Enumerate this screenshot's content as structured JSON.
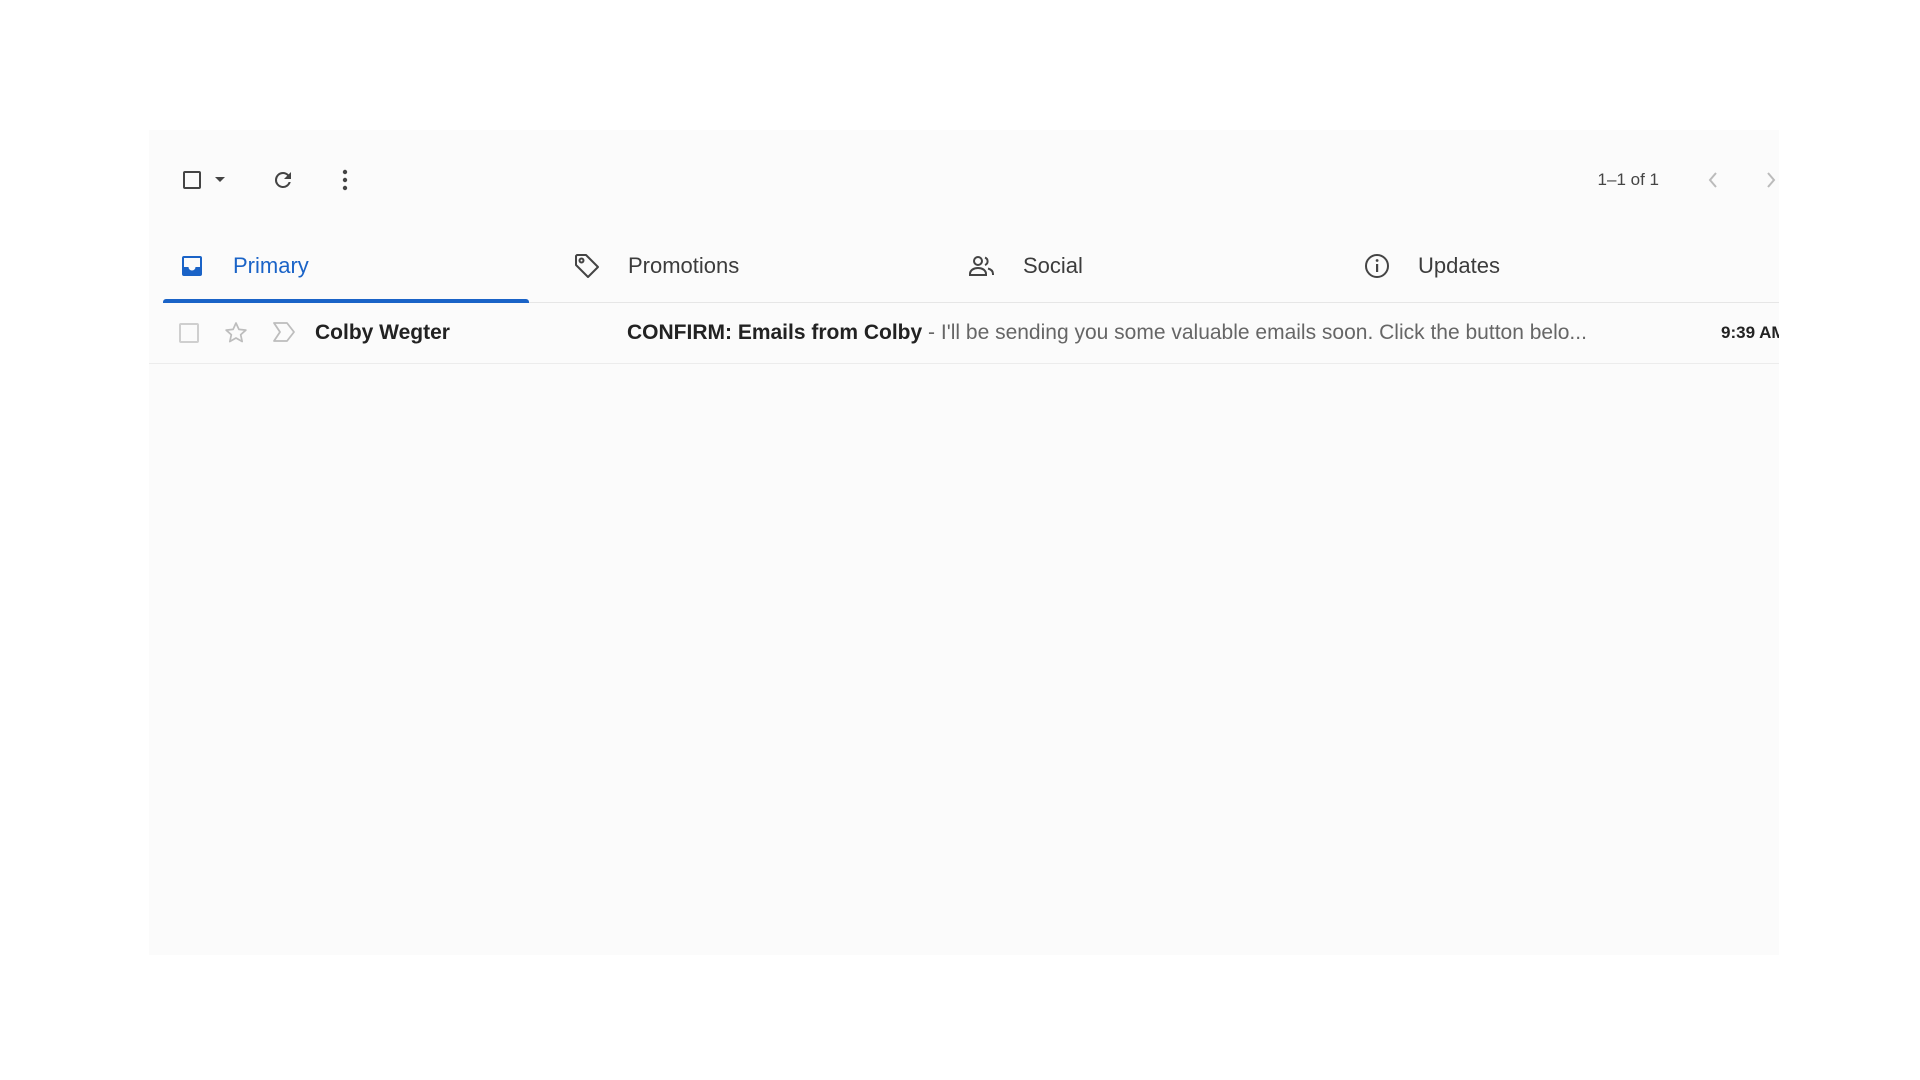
{
  "toolbar": {
    "pagination": "1–1 of 1"
  },
  "tabs": [
    {
      "label": "Primary",
      "icon": "inbox-icon",
      "active": true
    },
    {
      "label": "Promotions",
      "icon": "tag-icon",
      "active": false
    },
    {
      "label": "Social",
      "icon": "people-icon",
      "active": false
    },
    {
      "label": "Updates",
      "icon": "info-icon",
      "active": false
    }
  ],
  "messages": [
    {
      "sender": "Colby Wegter",
      "subject": "CONFIRM: Emails from Colby",
      "separator": " - ",
      "snippet": "I'll be sending you some valuable emails soon. Click the button belo...",
      "time": "9:39 AM"
    }
  ],
  "colors": {
    "accent": "#1a63c7",
    "panel_bg": "#fbfbfb",
    "text_primary": "#222222",
    "text_secondary": "#666666"
  }
}
